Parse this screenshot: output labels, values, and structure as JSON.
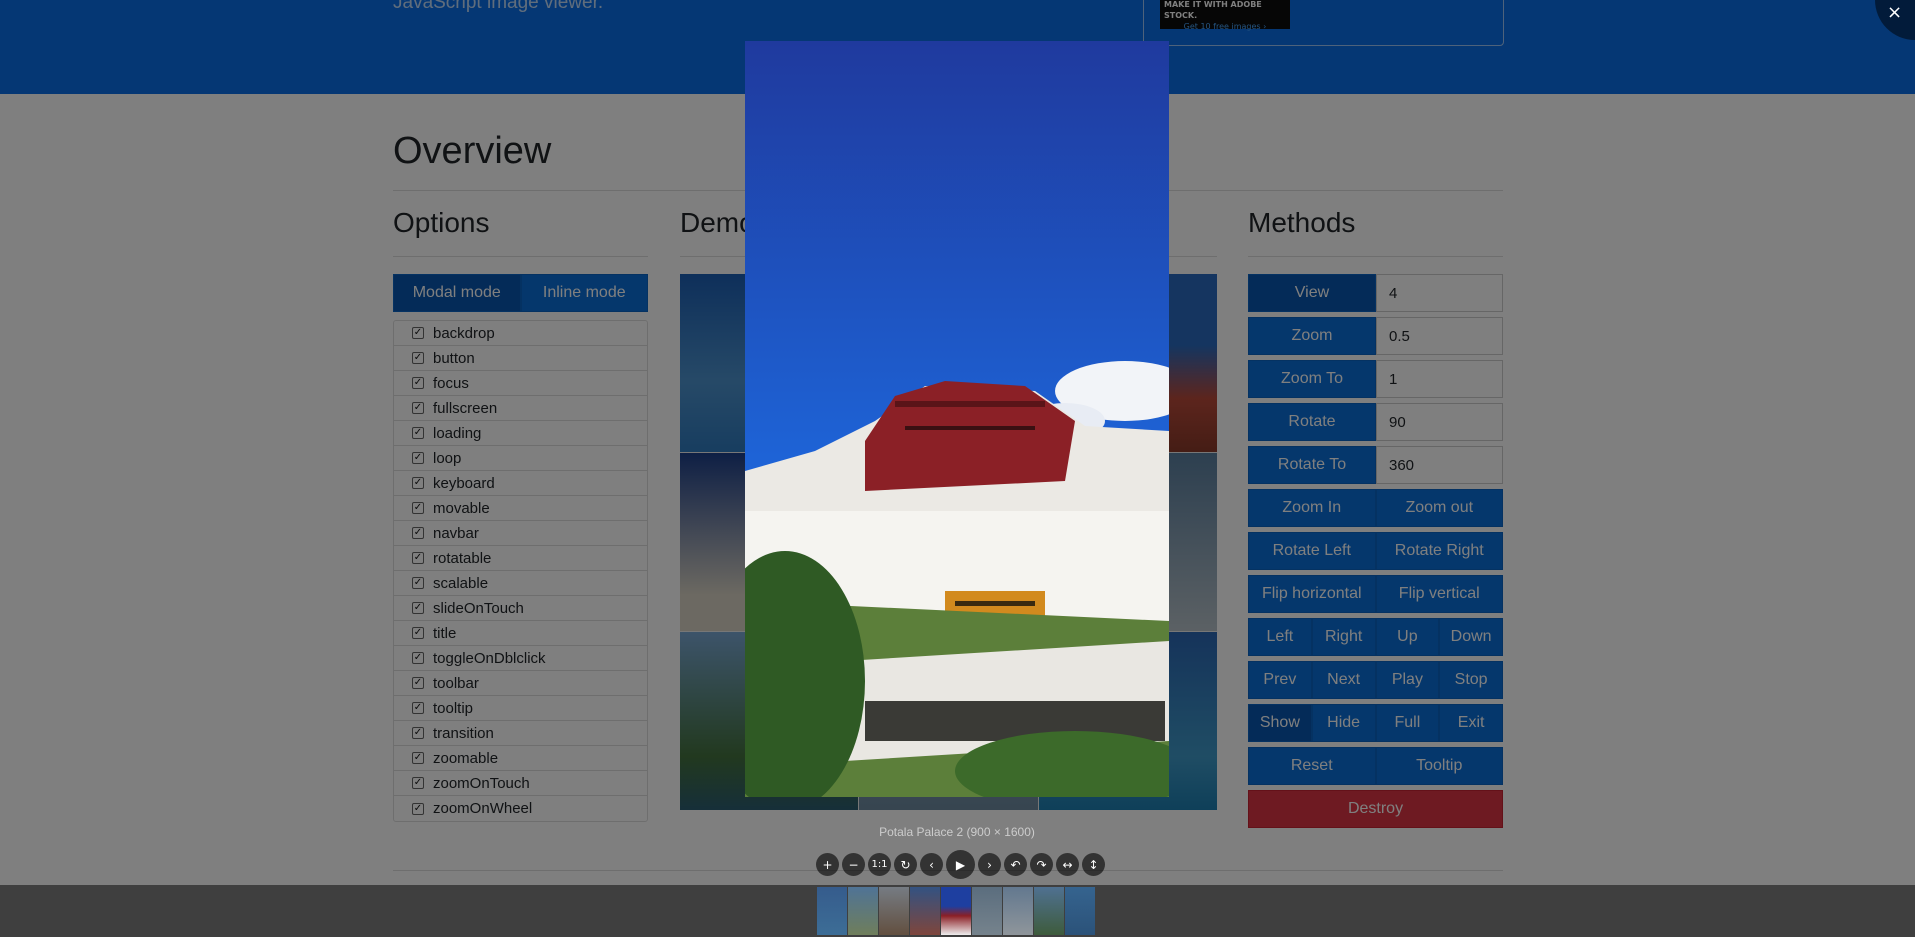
{
  "banner": {
    "subtitle": "JavaScript image viewer.",
    "ad_line1": "MAKE IT WITH ADOBE STOCK.",
    "ad_line2": "Get 10 free images ›"
  },
  "page": {
    "title": "Overview"
  },
  "columns": {
    "options": "Options",
    "demo": "Demo",
    "methods": "Methods"
  },
  "mode": {
    "modal": "Modal mode",
    "inline": "Inline mode"
  },
  "options": [
    "backdrop",
    "button",
    "focus",
    "fullscreen",
    "loading",
    "loop",
    "keyboard",
    "movable",
    "navbar",
    "rotatable",
    "scalable",
    "slideOnTouch",
    "title",
    "toggleOnDblclick",
    "toolbar",
    "tooltip",
    "transition",
    "zoomable",
    "zoomOnTouch",
    "zoomOnWheel"
  ],
  "methods": {
    "view": {
      "label": "View",
      "value": "4"
    },
    "zoom": {
      "label": "Zoom",
      "value": "0.5"
    },
    "zoomto": {
      "label": "Zoom To",
      "value": "1"
    },
    "rotate": {
      "label": "Rotate",
      "value": "90"
    },
    "rotateto": {
      "label": "Rotate To",
      "value": "360"
    },
    "zoom_in": "Zoom In",
    "zoom_out": "Zoom out",
    "rotate_left": "Rotate Left",
    "rotate_right": "Rotate Right",
    "flip_h": "Flip horizontal",
    "flip_v": "Flip vertical",
    "left": "Left",
    "right": "Right",
    "up": "Up",
    "down": "Down",
    "prev": "Prev",
    "next": "Next",
    "play": "Play",
    "stop": "Stop",
    "show": "Show",
    "hide": "Hide",
    "full": "Full",
    "exit": "Exit",
    "reset": "Reset",
    "tooltip": "Tooltip",
    "destroy": "Destroy"
  },
  "viewer": {
    "caption": "Potala Palace 2 (900 × 1600)",
    "close": "×"
  },
  "toolbar": [
    "zoom-in-icon",
    "zoom-out-icon",
    "one-to-one-icon",
    "reset-icon",
    "prev-icon",
    "play-icon",
    "next-icon",
    "rotate-left-icon",
    "rotate-right-icon",
    "flip-horizontal-icon",
    "flip-vertical-icon"
  ],
  "colors": {
    "primary": "#0b6fd9",
    "danger": "#dc3545",
    "banner": "#0a6fe8"
  }
}
